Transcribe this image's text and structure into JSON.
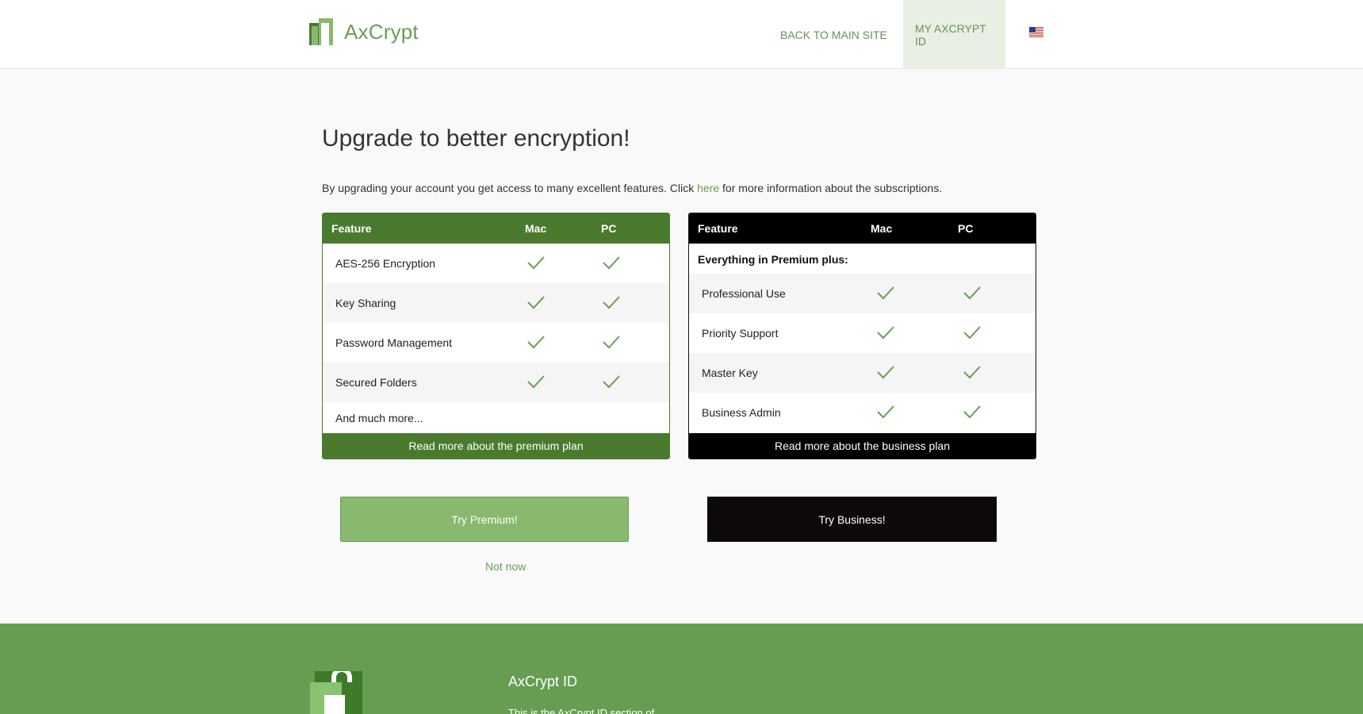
{
  "brand": {
    "name": "AxCrypt",
    "accent": "#6a9e55",
    "dark_green": "#4a7a2d"
  },
  "nav": {
    "back_label": "BACK TO MAIN SITE",
    "myid_label": "MY AXCRYPT ID",
    "flag_icon": "us-flag-icon"
  },
  "main": {
    "title": "Upgrade to better encryption!",
    "intro_before": "By upgrading your account you get access to many excellent features. Click ",
    "intro_link": "here",
    "intro_after": " for more information about the subscriptions."
  },
  "premium_table": {
    "headers": [
      "Feature",
      "Mac",
      "PC"
    ],
    "rows": [
      "AES-256 Encryption",
      "Key Sharing",
      "Password Management",
      "Secured Folders"
    ],
    "more": "And much more...",
    "footer_link": "Read more about the premium plan"
  },
  "business_table": {
    "headers": [
      "Feature",
      "Mac",
      "PC"
    ],
    "subheading": "Everything in Premium plus:",
    "rows": [
      "Professional Use",
      "Priority Support",
      "Master Key",
      "Business Admin"
    ],
    "footer_link": "Read more about the business plan"
  },
  "actions": {
    "try_premium": "Try Premium!",
    "try_business": "Try Business!",
    "not_now": "Not now"
  },
  "footer": {
    "title": "AxCrypt ID",
    "text": "This is the AxCrypt ID section of"
  }
}
